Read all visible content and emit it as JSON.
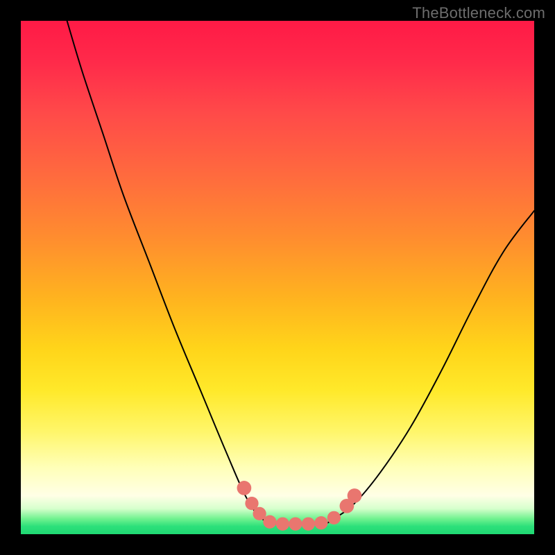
{
  "watermark": "TheBottleneck.com",
  "colors": {
    "background": "#000000",
    "curve": "#000000",
    "marker_fill": "#e9766f",
    "marker_stroke": "#c95a57"
  },
  "chart_data": {
    "type": "line",
    "title": "",
    "xlabel": "",
    "ylabel": "",
    "xlim": [
      0,
      100
    ],
    "ylim": [
      0,
      100
    ],
    "note": "No axis ticks or numeric labels are rendered. y is qualitative: 100=top (red, high bottleneck), 0=bottom (green, optimal). The minimum plateau sits roughly at x≈47–61 near y≈2.",
    "series": [
      {
        "name": "left-curve",
        "x": [
          9,
          12,
          16,
          20,
          25,
          30,
          35,
          40,
          44,
          47
        ],
        "values": [
          100,
          90,
          78,
          66,
          53,
          40,
          28,
          16,
          7,
          3
        ]
      },
      {
        "name": "plateau",
        "x": [
          47,
          50,
          53,
          56,
          59,
          61
        ],
        "values": [
          3,
          2,
          2,
          2,
          2,
          3
        ]
      },
      {
        "name": "right-curve",
        "x": [
          61,
          65,
          70,
          76,
          82,
          88,
          94,
          100
        ],
        "values": [
          3,
          6,
          12,
          21,
          32,
          44,
          55,
          63
        ]
      }
    ],
    "markers": {
      "name": "highlight-beads",
      "points": [
        {
          "x": 43.5,
          "y": 9,
          "r": 1.4
        },
        {
          "x": 45.0,
          "y": 6,
          "r": 1.3
        },
        {
          "x": 46.5,
          "y": 4,
          "r": 1.3
        },
        {
          "x": 48.5,
          "y": 2.4,
          "r": 1.3
        },
        {
          "x": 51.0,
          "y": 2.0,
          "r": 1.3
        },
        {
          "x": 53.5,
          "y": 2.0,
          "r": 1.3
        },
        {
          "x": 56.0,
          "y": 2.0,
          "r": 1.3
        },
        {
          "x": 58.5,
          "y": 2.2,
          "r": 1.3
        },
        {
          "x": 61.0,
          "y": 3.2,
          "r": 1.3
        },
        {
          "x": 63.5,
          "y": 5.5,
          "r": 1.4
        },
        {
          "x": 65.0,
          "y": 7.5,
          "r": 1.4
        }
      ]
    }
  }
}
